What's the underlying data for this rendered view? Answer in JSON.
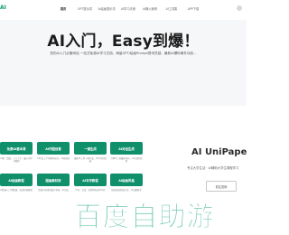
{
  "header": {
    "logo_text": "AI",
    "nav": [
      "首页",
      "GPT提示词",
      "AI绘画提示词",
      "AI学习手册",
      "AI爆火案例",
      "AI工具集",
      "APP下载"
    ]
  },
  "hero": {
    "title": "AI入门，Easy到爆！",
    "subtitle": "您的AI入门必备网站 一站式免费AI学习文档，海量GPT/绘画Prompt提词灵感，最新AI爆料事件动态..."
  },
  "cards": [
    {
      "label": "免费AI基本课",
      "desc": "AI课、绘图、入门上手，最火的学习教程"
    },
    {
      "label": "AI作图创意",
      "desc": "AI作品上手有趣好玩的，AI创意画"
    },
    {
      "label": "一键生成",
      "desc": "最新AI工具一键生成，AI写作和绘画"
    },
    {
      "label": "AI对话生成",
      "desc": "了解AI工具最新动向，AI对话和应用"
    },
    {
      "label": "AI绘画教程",
      "desc": "AI绘画入门到精通，各类风格教程"
    },
    {
      "label": "图画素材库",
      "desc": "免费可商用的图片素材，AI生成"
    },
    {
      "label": "AI写作教程",
      "desc": "写作、文案、营销等各类AI写作"
    },
    {
      "label": "AI绘画风格",
      "desc": "各类绘画风格汇总，AI出图参考"
    }
  ],
  "panel": {
    "title": "AI UniPape",
    "subtitle": "专注大学生活 · AI辅助大学生课程学习",
    "button_label": "前往官网"
  },
  "watermark": {
    "text": "百度自助游"
  },
  "colors": {
    "brand": "#0f8f6a",
    "hero_bg": "#f6f7f9"
  }
}
